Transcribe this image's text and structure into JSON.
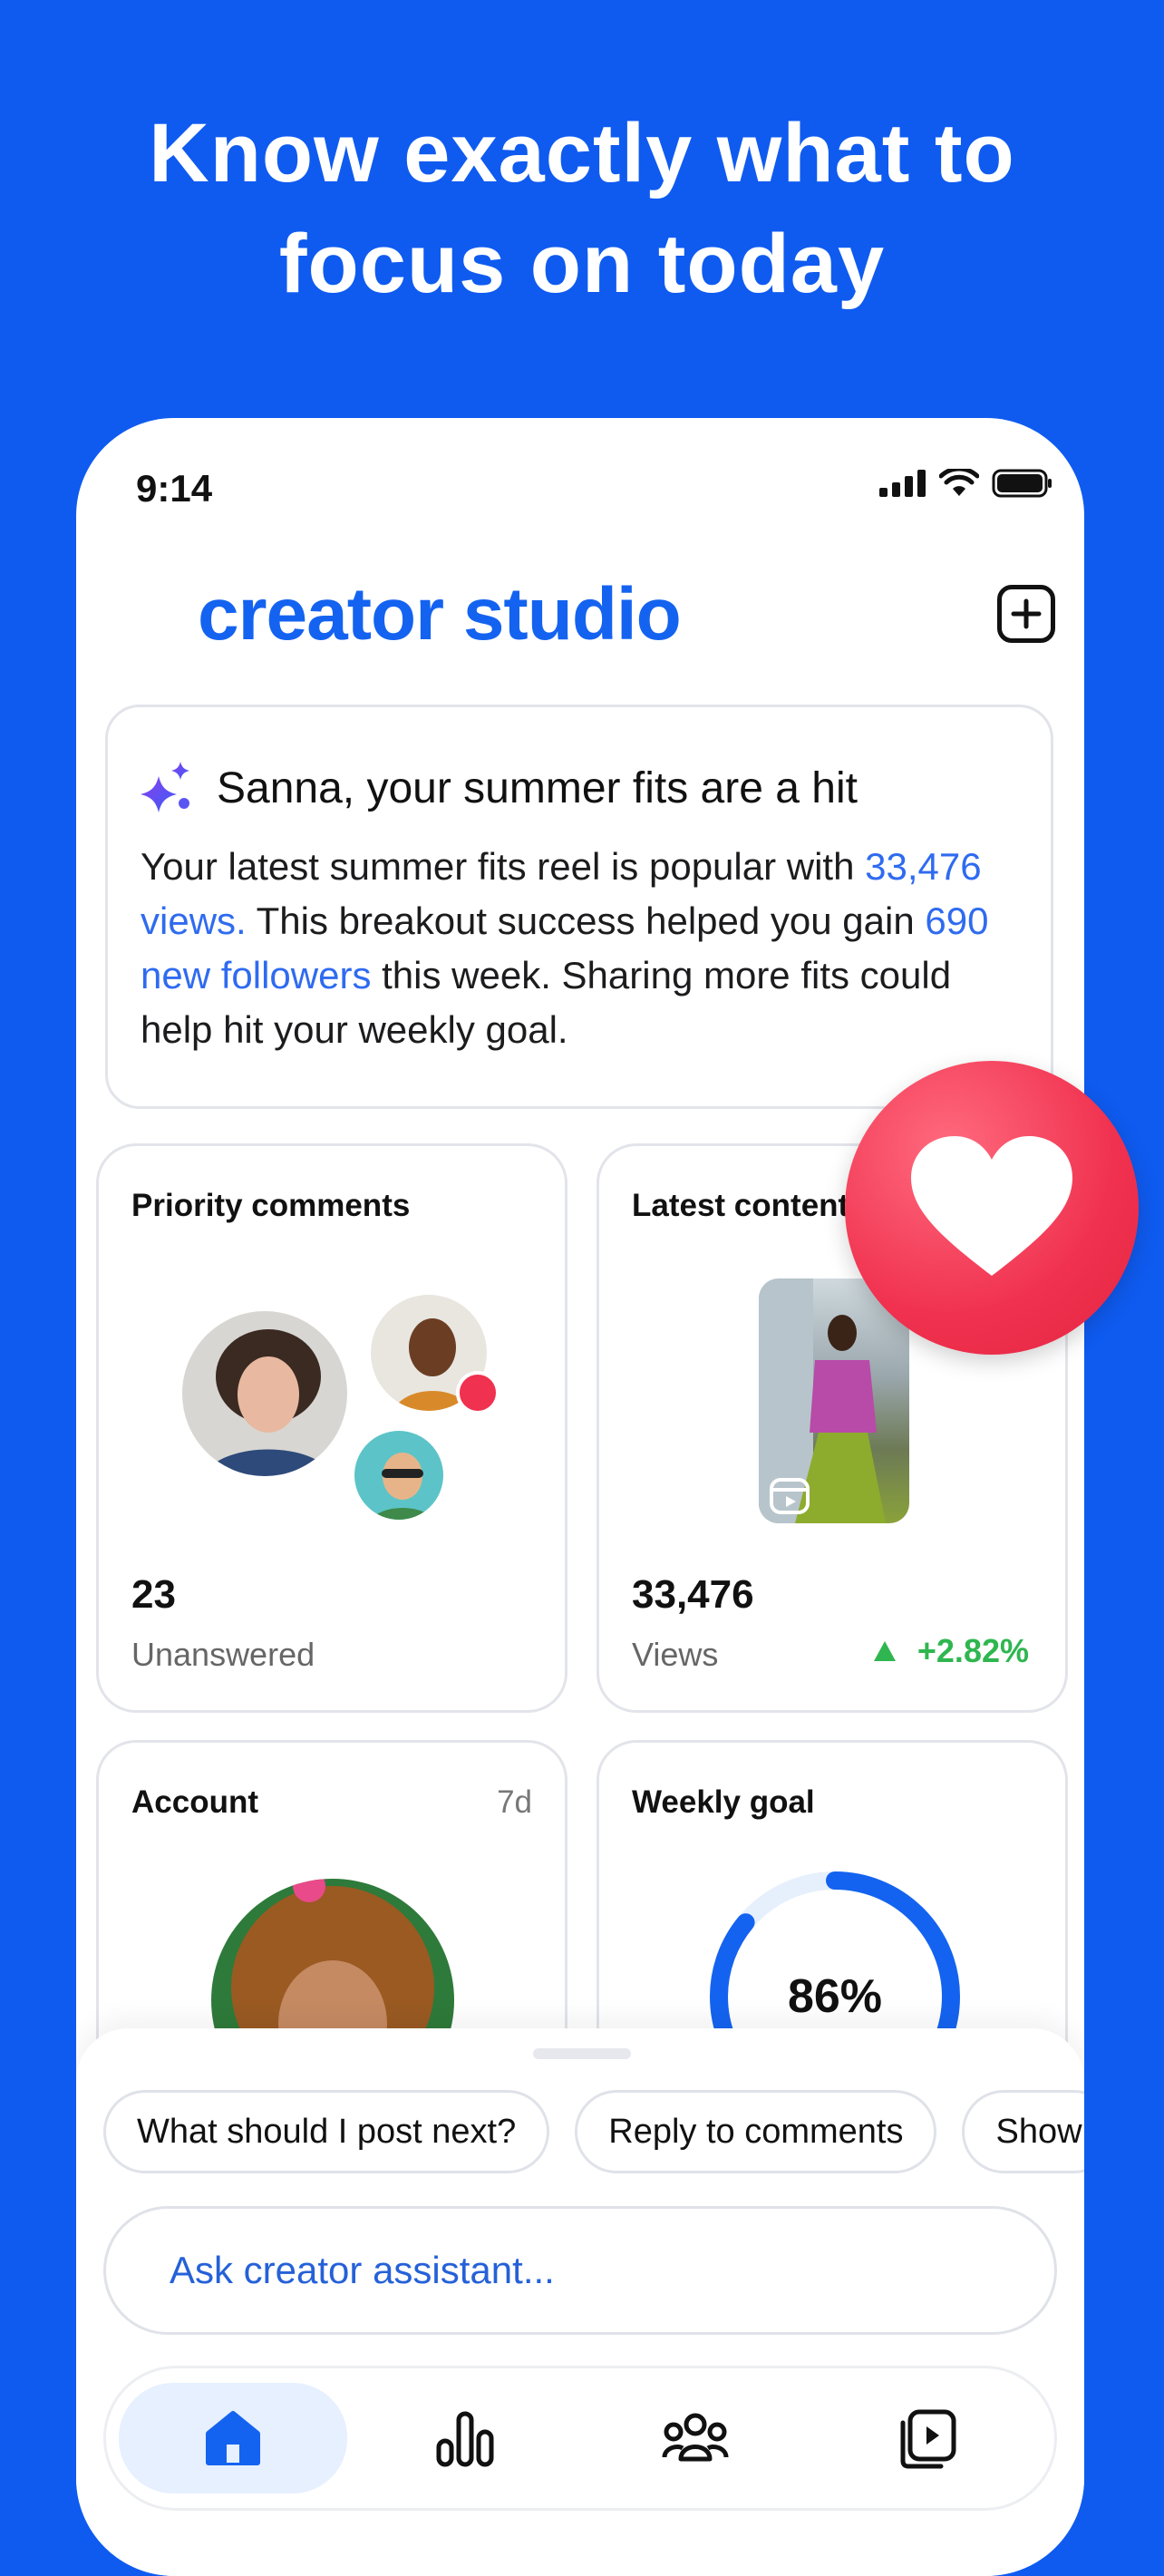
{
  "colors": {
    "brand": "#0f5bf0",
    "link": "#2f6bf0",
    "positive": "#2fb650",
    "heart": "#f0314f"
  },
  "headline": {
    "line1": "Know exactly what to",
    "line2": "focus on today"
  },
  "status_bar": {
    "time": "9:14",
    "icons": [
      "signal-icon",
      "wifi-icon",
      "battery-icon"
    ]
  },
  "app": {
    "title": "creator studio",
    "compose_icon": "plus-square-icon"
  },
  "insight": {
    "icon": "sparkle-icon",
    "title": "Sanna, your summer fits are a hit",
    "body_1": "Your latest summer fits reel is popular with ",
    "views": "33,476 views.",
    "body_2": " This breakout success helped you gain ",
    "followers": "690 new followers",
    "body_3": " this week. Sharing more fits could help hit your weekly goal."
  },
  "cards": {
    "priority_comments": {
      "title": "Priority comments",
      "count": "23",
      "label": "Unanswered"
    },
    "latest_content": {
      "title": "Latest content",
      "count": "33,476",
      "label": "Views",
      "delta": "+2.82%",
      "badge_icon": "reel-icon"
    },
    "account": {
      "title": "Account",
      "period": "7d"
    },
    "weekly_goal": {
      "title": "Weekly goal",
      "percent": "86%",
      "progress": 0.86
    }
  },
  "reaction": {
    "icon": "heart-icon"
  },
  "assistant": {
    "chips": [
      "What should I post next?",
      "Reply to comments",
      "Show"
    ],
    "placeholder": "Ask creator assistant..."
  },
  "tabbar": [
    {
      "name": "home",
      "icon": "home-icon",
      "active": true
    },
    {
      "name": "insights",
      "icon": "bar-chart-icon",
      "active": false
    },
    {
      "name": "community",
      "icon": "people-icon",
      "active": false
    },
    {
      "name": "content",
      "icon": "video-library-icon",
      "active": false
    }
  ]
}
